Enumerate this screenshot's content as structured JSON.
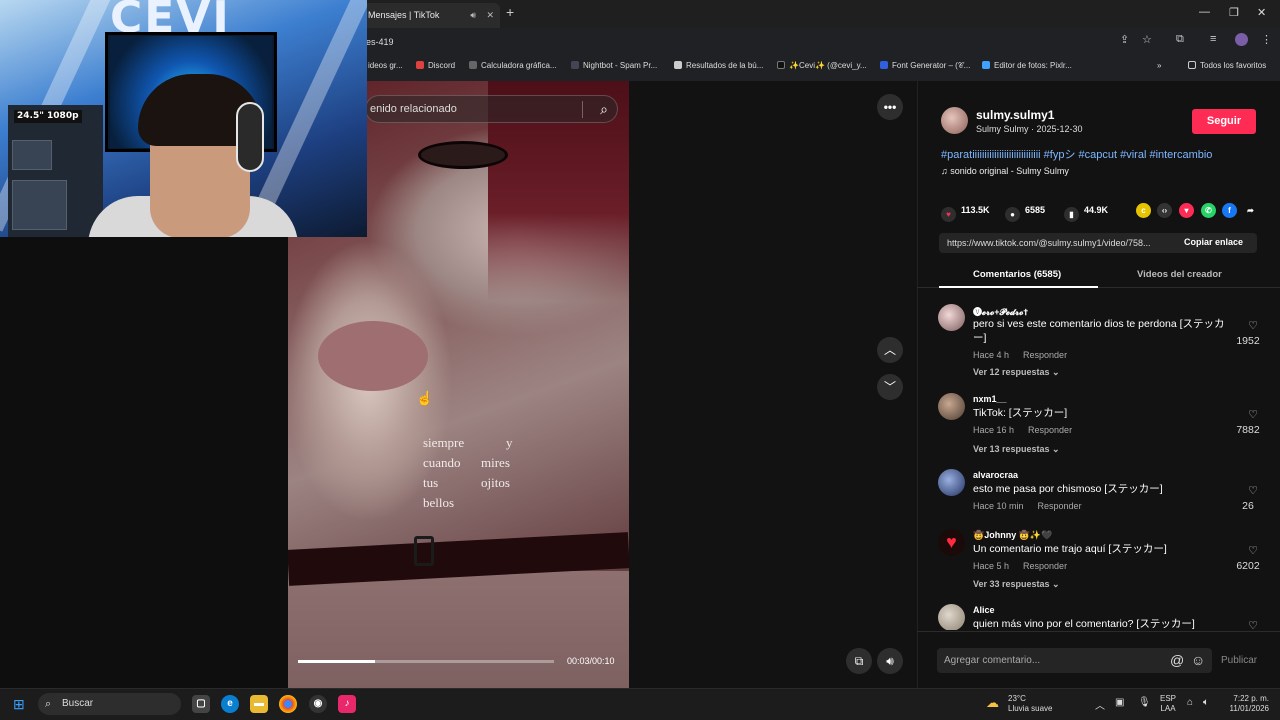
{
  "browser": {
    "tab_title": "Mensajes | TikTok",
    "url_fragment": "es-419",
    "bookmarks": [
      "ideos gr...",
      "Discord",
      "Calculadora gráfica...",
      "Nightbot - Spam Pr...",
      "Resultados de la bú...",
      "✨Cevi✨ (@cevi_y...",
      "Font Generator – (𝒞...",
      "Editor de fotos: Pixlr..."
    ],
    "all_favorites": "Todos los favoritos"
  },
  "webcam": {
    "logo_text": "CEVI",
    "monitor_label": "24.5\" 1080p"
  },
  "video": {
    "search_placeholder": "enido relacionado",
    "lyrics_left": [
      "siempre",
      "cuando",
      "tus",
      "bellos"
    ],
    "lyrics_right": [
      "y",
      "mires",
      "ojitos"
    ],
    "progress": 0.3,
    "timecode": "00:03/00:10"
  },
  "post": {
    "username": "sulmy.sulmy1",
    "subline": "Sulmy Sulmy · 2025-12-30",
    "follow_label": "Seguir",
    "hashtags": "#paratiiiiiiiiiiiiiiiiiiiiiiiiiiii #fypシ #capcut #viral #intercambio",
    "sound": "sonido original - Sulmy Sulmy",
    "likes": "113.5K",
    "comments": "6585",
    "saves": "44.9K",
    "link": "https://www.tiktok.com/@sulmy.sulmy1/video/758...",
    "copy_link": "Copiar enlace"
  },
  "tabs": {
    "comments": "Comentarios (6585)",
    "creator_videos": "Videos del creador"
  },
  "comments": [
    {
      "user": "🅥𝓮𝓻𝓸+𝓟𝓮𝓭𝓻𝓸✝",
      "text": "pero si ves este comentario dios te perdona [ステッカー]",
      "time": "Hace 4 h",
      "reply": "Responder",
      "replies": "Ver 12 respuestas ⌄",
      "likes": "1952"
    },
    {
      "user": "nxm1__",
      "text": "TikTok: [ステッカー]",
      "time": "Hace 16 h",
      "reply": "Responder",
      "replies": "Ver 13 respuestas ⌄",
      "likes": "7882"
    },
    {
      "user": "alvarocraa",
      "text": "esto me pasa por chismoso [ステッカー]",
      "time": "Hace 10 min",
      "reply": "Responder",
      "replies": "",
      "likes": "26"
    },
    {
      "user": "🤠Johnny 🤠✨🖤",
      "text": "Un comentario me trajo aquí [ステッカー]",
      "time": "Hace 5 h",
      "reply": "Responder",
      "replies": "Ver 33 respuestas ⌄",
      "likes": "6202"
    },
    {
      "user": "Alice",
      "text": "quien más vino por el comentario? [ステッカー]",
      "time": "",
      "reply": "",
      "replies": "",
      "likes": ""
    }
  ],
  "add_comment": {
    "placeholder": "Agregar comentario...",
    "publish": "Publicar"
  },
  "taskbar": {
    "search": "Buscar",
    "temp": "23°C",
    "weather": "Lluvia suave",
    "lang1": "ESP",
    "lang2": "LAA",
    "time": "7:22 p. m.",
    "date": "11/01/2026"
  },
  "colors": {
    "accent": "#fe2c55",
    "hashtag": "#7fb7ff"
  }
}
